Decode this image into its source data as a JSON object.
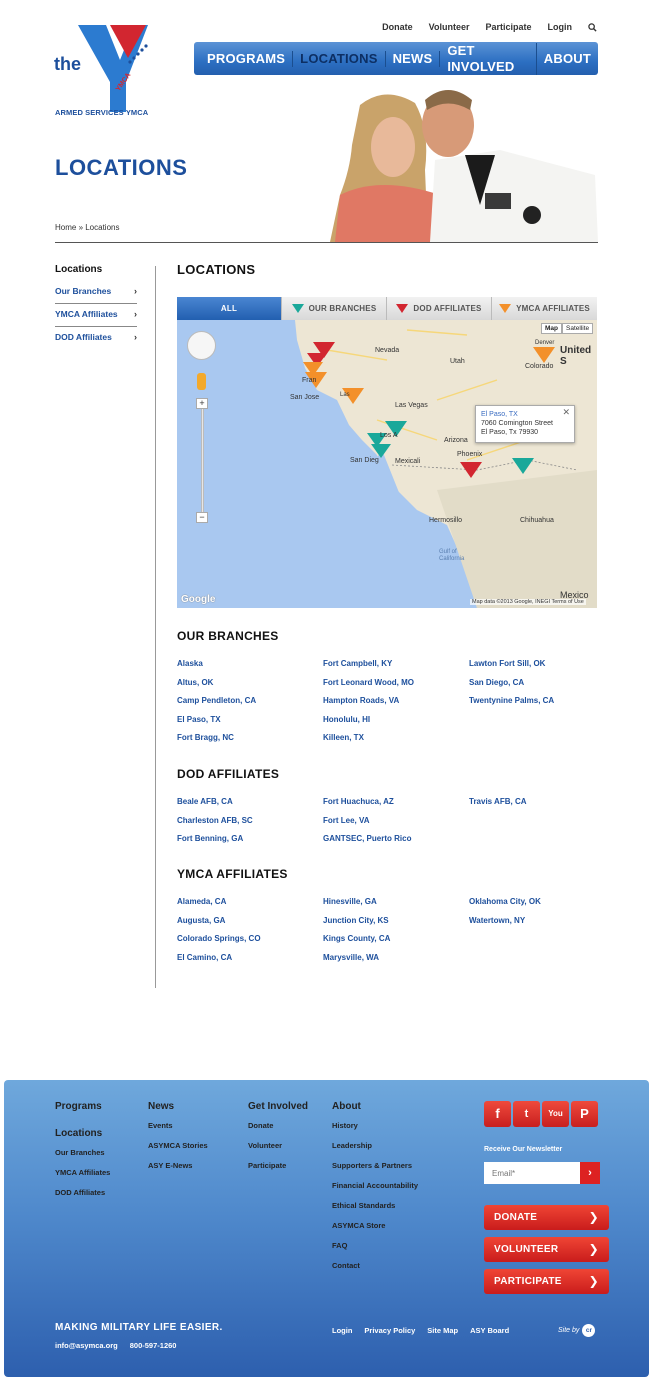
{
  "brand": {
    "logo_word": "the",
    "logo_tag": "YMCA",
    "org_name": "ARMED SERVICES YMCA",
    "colors": {
      "primary": "#1d4f9c",
      "red": "#d22630",
      "teal": "#1aa89a",
      "orange": "#f3902a"
    }
  },
  "util_nav": [
    "Donate",
    "Volunteer",
    "Participate",
    "Login"
  ],
  "main_nav": [
    {
      "label": "PROGRAMS",
      "active": false
    },
    {
      "label": "LOCATIONS",
      "active": true
    },
    {
      "label": "NEWS",
      "active": false
    },
    {
      "label": "GET INVOLVED",
      "active": false
    },
    {
      "label": "ABOUT",
      "active": false
    }
  ],
  "page": {
    "title": "LOCATIONS",
    "breadcrumb": "Home » Locations"
  },
  "sidebar": {
    "title": "Locations",
    "items": [
      "Our Branches",
      "YMCA Affiliates",
      "DOD Affiliates"
    ]
  },
  "content": {
    "heading": "LOCATIONS",
    "tabs": [
      {
        "label": "ALL",
        "icon": "",
        "active": true
      },
      {
        "label": "OUR BRANCHES",
        "icon": "teal-marker-icon",
        "active": false
      },
      {
        "label": "DOD AFFILIATES",
        "icon": "red-marker-icon",
        "active": false
      },
      {
        "label": "YMCA AFFILIATES",
        "icon": "orange-marker-icon",
        "active": false
      }
    ],
    "map": {
      "type_buttons": [
        "Map",
        "Satellite"
      ],
      "labels": {
        "nevada": "Nevada",
        "utah": "Utah",
        "united_states": "United S",
        "colorado": "Colorado",
        "denver": "Denver",
        "san_jose": "San Jose",
        "las_vegas": "Las Vegas",
        "arizona": "Arizona",
        "phoenix": "Phoenix",
        "los_angeles": "Los A",
        "san_diego": "San Dieg",
        "mexicali": "Mexicali",
        "hermosillo": "Hermosillo",
        "chihuahua": "Chihuahua",
        "gulf": "Gulf of California",
        "mexico": "Mexico",
        "fran": "Fran",
        "las": "Las"
      },
      "info_window": {
        "city": "El Paso, TX",
        "street": "7060 Comington Street",
        "citystate": "El Paso, Tx 79930"
      },
      "google": "Google",
      "credit": "Map data ©2013 Google, INEGI   Terms of Use"
    }
  },
  "sections": {
    "branches": {
      "title": "OUR BRANCHES",
      "items": [
        "Alaska",
        "Fort Campbell, KY",
        "Lawton Fort Sill, OK",
        "Altus, OK",
        "Fort Leonard Wood, MO",
        "San Diego, CA",
        "Camp Pendleton, CA",
        "Hampton Roads, VA",
        "Twentynine Palms, CA",
        "El Paso, TX",
        "Honolulu, HI",
        "",
        "Fort Bragg, NC",
        "Killeen, TX",
        ""
      ]
    },
    "dod": {
      "title": "DOD AFFILIATES",
      "items": [
        "Beale AFB, CA",
        "Fort Huachuca, AZ",
        "Travis AFB, CA",
        "Charleston AFB, SC",
        "Fort Lee, VA",
        "",
        "Fort Benning, GA",
        "GANTSEC, Puerto Rico",
        ""
      ]
    },
    "ymca": {
      "title": "YMCA AFFILIATES",
      "items": [
        "Alameda, CA",
        "Hinesville, GA",
        "Oklahoma City, OK",
        "Augusta, GA",
        "Junction City, KS",
        "Watertown, NY",
        "Colorado Springs, CO",
        "Kings County, CA",
        "",
        "El Camino, CA",
        "Marysville, WA",
        ""
      ]
    }
  },
  "footer": {
    "col1": {
      "title": "Programs",
      "title2": "Locations",
      "links": [
        "Our Branches",
        "YMCA Affiliates",
        "DOD Affiliates"
      ]
    },
    "col2": {
      "title": "News",
      "links": [
        "Events",
        "ASYMCA Stories",
        "ASY E-News"
      ]
    },
    "col3": {
      "title": "Get Involved",
      "links": [
        "Donate",
        "Volunteer",
        "Participate"
      ]
    },
    "col4": {
      "title": "About",
      "links": [
        "History",
        "Leadership",
        "Supporters & Partners",
        "Financial Accountability",
        "Ethical Standards",
        "ASYMCA Store",
        "FAQ",
        "Contact"
      ]
    },
    "social": [
      "f",
      "t",
      "You",
      "P"
    ],
    "newsletter_label": "Receive Our Newsletter",
    "email_placeholder": "Email*",
    "cta": [
      "DONATE",
      "VOLUNTEER",
      "PARTICIPATE"
    ],
    "tagline": "MAKING MILITARY LIFE EASIER.",
    "email": "info@asymca.org",
    "phone": "800-597-1260",
    "bottom_links": [
      "Login",
      "Privacy Policy",
      "Site Map",
      "ASY Board"
    ],
    "site_by": "Site by",
    "site_by_badge": "cr"
  }
}
